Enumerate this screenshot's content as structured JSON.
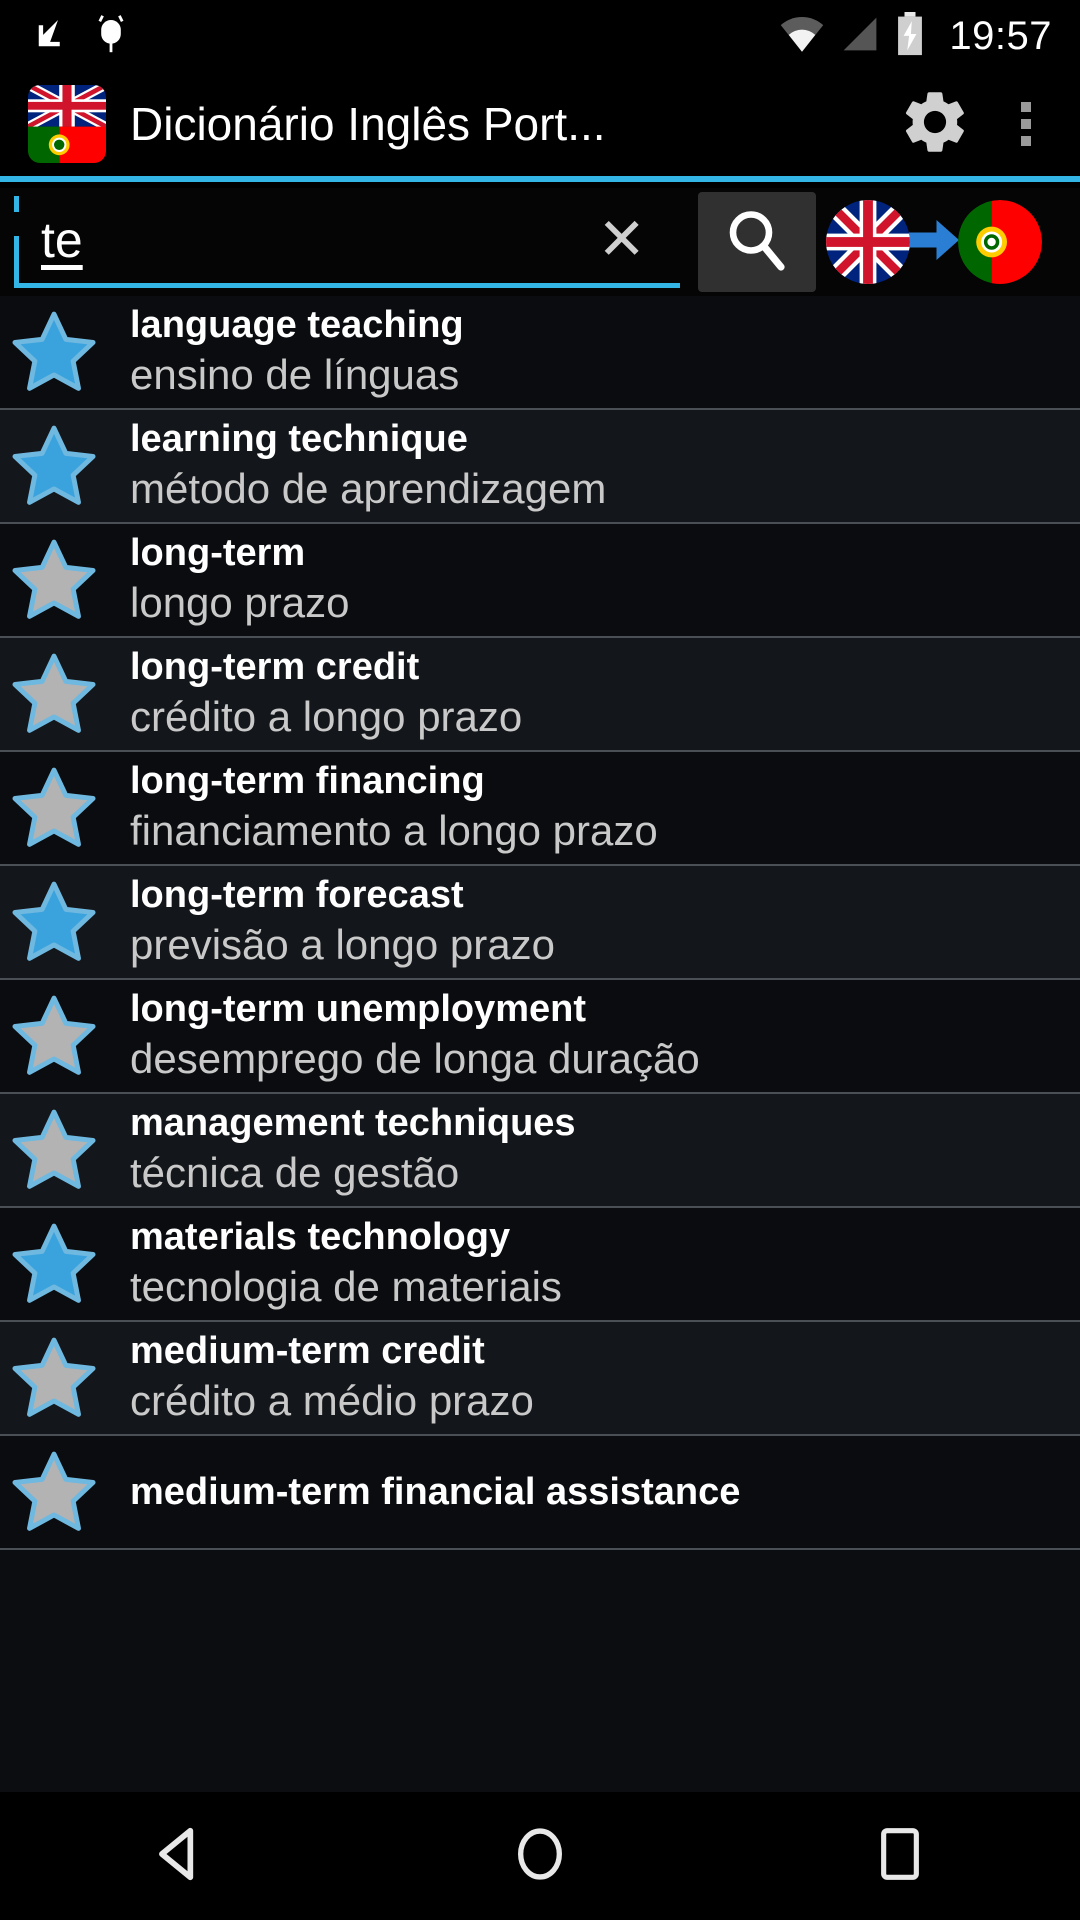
{
  "status_bar": {
    "time": "19:57",
    "icons": [
      "download-arrow-icon",
      "usb-debug-icon",
      "wifi-icon",
      "cell-signal-icon",
      "battery-charging-icon"
    ]
  },
  "action_bar": {
    "title": "Dicionário Inglês Port...",
    "app_icon": "uk-portugal-flag-icon",
    "settings_icon": "gear-icon",
    "overflow_icon": "overflow-menu-icon"
  },
  "search": {
    "value": "te",
    "placeholder": "",
    "clear_label": "✕",
    "search_icon": "magnifier-icon",
    "source_flag": "uk-flag-icon",
    "direction_icon": "arrow-right-icon",
    "target_flag": "portugal-flag-icon",
    "accent_color": "#33b5e5"
  },
  "results": [
    {
      "term": "language teaching",
      "translation": "ensino de línguas",
      "starred": true
    },
    {
      "term": "learning technique",
      "translation": "método de aprendizagem",
      "starred": true
    },
    {
      "term": "long-term",
      "translation": "longo prazo",
      "starred": false
    },
    {
      "term": "long-term credit",
      "translation": "crédito a longo prazo",
      "starred": false
    },
    {
      "term": "long-term financing",
      "translation": "financiamento a longo prazo",
      "starred": false
    },
    {
      "term": "long-term forecast",
      "translation": "previsão a longo prazo",
      "starred": true
    },
    {
      "term": "long-term unemployment",
      "translation": "desemprego de longa duração",
      "starred": false
    },
    {
      "term": "management techniques",
      "translation": "técnica de gestão",
      "starred": false
    },
    {
      "term": "materials technology",
      "translation": "tecnologia de materiais",
      "starred": true
    },
    {
      "term": "medium-term credit",
      "translation": "crédito a médio prazo",
      "starred": false
    },
    {
      "term": "medium-term financial assistance",
      "translation": "",
      "starred": false
    }
  ],
  "nav_bar": {
    "back": "back-triangle-icon",
    "home": "home-circle-icon",
    "recents": "recents-square-icon"
  },
  "colors": {
    "star_active": "#3aa3dd",
    "star_inactive": "#b3b3b3",
    "accent": "#33b5e5"
  }
}
